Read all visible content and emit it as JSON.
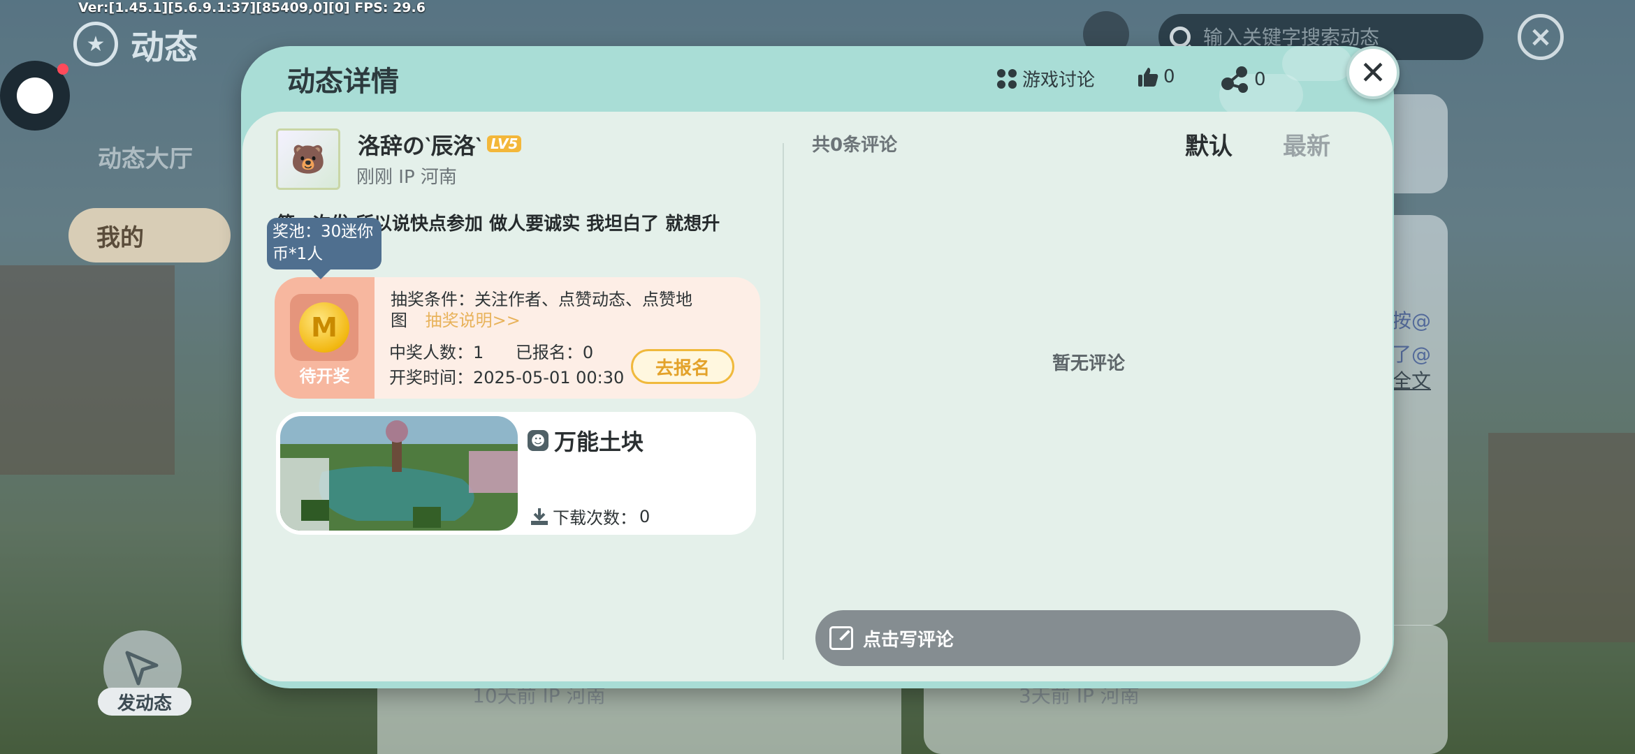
{
  "debug": {
    "version_text": "Ver:[1.45.1][5.6.9.1:37][85409,0][0] FPS: 29.6"
  },
  "background": {
    "page_title": "动态",
    "sidebar": [
      {
        "label": "动态大厅"
      },
      {
        "label": "我的"
      }
    ],
    "search_placeholder": "输入关键字搜索动态",
    "post_button_label": "发动态",
    "card_fragments": [
      "按@",
      "了@",
      "全文",
      "10天前 IP 河南",
      "3天前 IP 河南"
    ]
  },
  "modal": {
    "title": "动态详情",
    "actions": {
      "discussion_label": "游戏讨论",
      "like_count": "0",
      "share_count": "0"
    },
    "post": {
      "user_name": "洛辞の‵辰洛‵",
      "level": "LV5",
      "time": "刚刚",
      "ip": "IP 河南",
      "text": "第一次发 所以说快点参加 做人要诚实 我坦白了 就想升"
    },
    "tooltip": {
      "line1": "奖池：30迷你",
      "line2": "币*1人"
    },
    "lottery": {
      "status": "待开奖",
      "condition_label": "抽奖条件：",
      "condition_text": "关注作者、点赞动态、点赞地",
      "condition_text2": "图",
      "explain_link": "抽奖说明>>",
      "winners_label": "中奖人数：",
      "winners": "1",
      "registered_label": "已报名：",
      "registered": "0",
      "draw_time_label": "开奖时间：",
      "draw_time": "2025-05-01 00:30",
      "signup_button": "去报名"
    },
    "map": {
      "name": "万能土块",
      "downloads_label": "下载次数：",
      "downloads": "0"
    },
    "comments": {
      "count_text": "共0条评论",
      "sort_default": "默认",
      "sort_newest": "最新",
      "empty_text": "暂无评论",
      "write_placeholder": "点击写评论"
    }
  }
}
